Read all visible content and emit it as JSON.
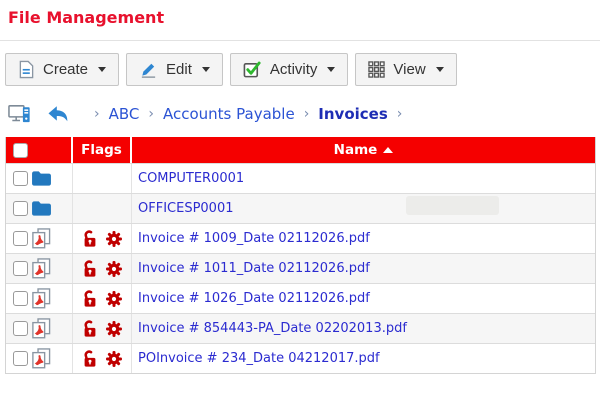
{
  "page": {
    "title": "File Management"
  },
  "toolbar": {
    "buttons": [
      {
        "label": "Create",
        "icon": "new-document-icon"
      },
      {
        "label": "Edit",
        "icon": "pencil-icon"
      },
      {
        "label": "Activity",
        "icon": "checked-checkbox-icon"
      },
      {
        "label": "View",
        "icon": "grid-icon"
      }
    ]
  },
  "breadcrumb": {
    "separator": "›",
    "items": [
      {
        "label": "ABC",
        "current": false
      },
      {
        "label": "Accounts Payable",
        "current": false
      },
      {
        "label": "Invoices",
        "current": true
      }
    ]
  },
  "table": {
    "header": {
      "flags": "Flags",
      "name": "Name",
      "sort": "ascending"
    },
    "rows": [
      {
        "type": "folder",
        "name": "COMPUTER0001",
        "flags": []
      },
      {
        "type": "folder",
        "name": "OFFICESP0001",
        "flags": []
      },
      {
        "type": "pdf",
        "name": "Invoice # 1009_Date 02112026.pdf",
        "flags": [
          "unlocked",
          "gear"
        ]
      },
      {
        "type": "pdf",
        "name": "Invoice # 1011_Date 02112026.pdf",
        "flags": [
          "unlocked",
          "gear"
        ]
      },
      {
        "type": "pdf",
        "name": "Invoice # 1026_Date 02112026.pdf",
        "flags": [
          "unlocked",
          "gear"
        ]
      },
      {
        "type": "pdf",
        "name": "Invoice # 854443-PA_Date 02202013.pdf",
        "flags": [
          "unlocked",
          "gear"
        ]
      },
      {
        "type": "pdf",
        "name": "POInvoice # 234_Date 04212017.pdf",
        "flags": [
          "unlocked",
          "gear"
        ]
      }
    ]
  },
  "colors": {
    "title_red": "#e8112d",
    "header_red": "#f50000",
    "link_blue": "#2b2bd0",
    "breadcrumb_blue": "#2b53d4",
    "breadcrumb_current_blue": "#1e2db4",
    "folder_blue": "#2278be",
    "flag_red": "#c00000",
    "pdf_mark_red": "#e0342b",
    "check_green": "#2eb82e",
    "alt_row_bg": "#f6f6f6"
  }
}
